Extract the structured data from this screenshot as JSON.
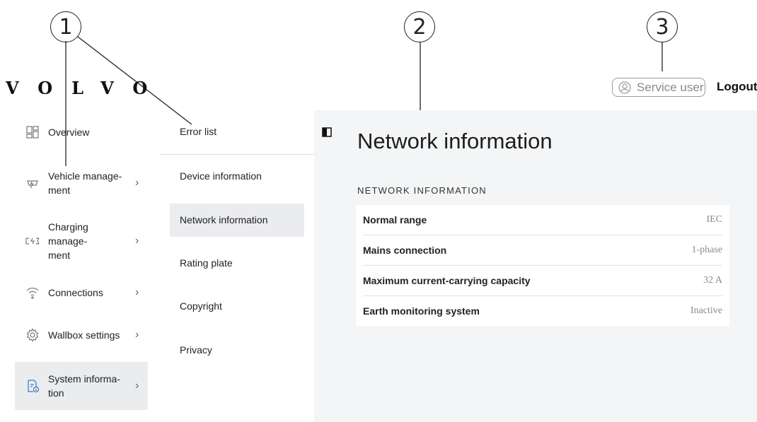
{
  "callouts": [
    "1",
    "2",
    "3"
  ],
  "header": {
    "logo": "VOLVO",
    "user_role": "Service user",
    "logout_label": "Logout"
  },
  "sidebar": {
    "items": [
      {
        "label": "Overview",
        "icon": "grid-icon",
        "has_chevron": false
      },
      {
        "label": "Vehicle manage-\nment",
        "icon": "car-plug-icon",
        "has_chevron": true
      },
      {
        "label": "Charging manage-\nment",
        "icon": "charging-icon",
        "has_chevron": true
      },
      {
        "label": "Connections",
        "icon": "wifi-icon",
        "has_chevron": true
      },
      {
        "label": "Wallbox settings",
        "icon": "gear-icon",
        "has_chevron": true
      },
      {
        "label": "System informa-\ntion",
        "icon": "document-info-icon",
        "has_chevron": true,
        "active": true
      }
    ]
  },
  "submenu": {
    "items": [
      {
        "label": "Error list"
      },
      {
        "label": "Device information"
      },
      {
        "label": "Network information",
        "active": true
      },
      {
        "label": "Rating plate"
      },
      {
        "label": "Copyright"
      },
      {
        "label": "Privacy"
      }
    ]
  },
  "main": {
    "title": "Network information",
    "section_label": "NETWORK INFORMATION",
    "rows": [
      {
        "key": "Normal range",
        "value": "IEC"
      },
      {
        "key": "Mains connection",
        "value": "1-phase"
      },
      {
        "key": "Maximum current-carrying capacity",
        "value": "32 A"
      },
      {
        "key": "Earth monitoring system",
        "value": "Inactive"
      }
    ]
  },
  "colors": {
    "active_bg": "#ebecee",
    "panel_bg": "#f4f5f6",
    "muted_text": "#8a8a8a"
  }
}
